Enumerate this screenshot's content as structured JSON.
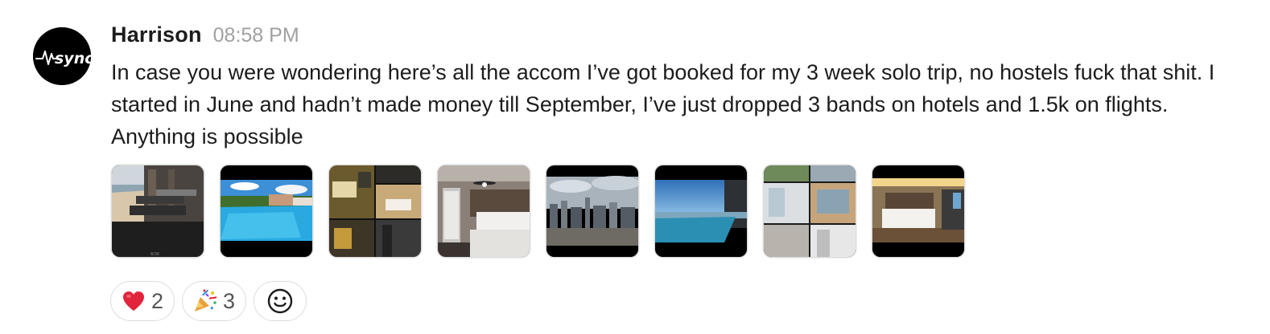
{
  "message": {
    "author": "Harrison",
    "timestamp": "08:58 PM",
    "text": "In case you were wondering here’s all the accom I’ve got booked for my 3 week solo trip, no hostels fuck that shit. I started in June and hadn’t made money till September, I’ve just dropped 3 bands on hotels and 1.5k on flights. Anything is possible",
    "avatar": {
      "logo_text": "sync",
      "icon": "sync-logo-icon"
    }
  },
  "attachments": [
    {
      "subject": "beachfront restaurant seating"
    },
    {
      "subject": "resort swimming pool"
    },
    {
      "subject": "hotel room collage"
    },
    {
      "subject": "hotel bedroom with ceiling fan"
    },
    {
      "subject": "city skyline view"
    },
    {
      "subject": "rooftop infinity pool"
    },
    {
      "subject": "apartment collage"
    },
    {
      "subject": "modern hotel bedroom"
    }
  ],
  "reactions": [
    {
      "emoji": "heart",
      "count": "2"
    },
    {
      "emoji": "party-popper",
      "count": "3"
    }
  ],
  "add_reaction": {
    "icon": "smiley-add-icon"
  },
  "colors": {
    "text": "#1d1c1d",
    "timestamp": "#a0a0a0",
    "border": "#dddddd"
  }
}
